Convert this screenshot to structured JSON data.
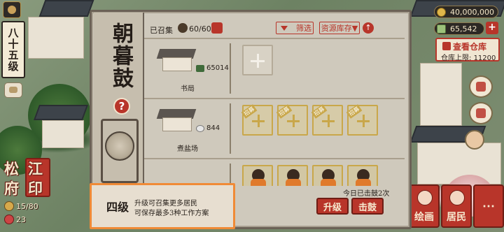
{
  "rank": {
    "title": "八十五级"
  },
  "city": {
    "name_part1": "松",
    "name_part2": "江",
    "name_part3": "府",
    "name_part4": "印",
    "population": "15/80",
    "other": "23"
  },
  "resources": {
    "coins": "40,000,000",
    "cash": "65,542",
    "plus_label": "+"
  },
  "warehouse": {
    "button_label": "查看仓库",
    "limit_label": "仓库上限:",
    "limit_value": "11200"
  },
  "side_buttons": {
    "painting": "绘画",
    "residents": "居民",
    "more": "⋯"
  },
  "dialog": {
    "title": "朝暮鼓",
    "help": "?",
    "recruited_label": "已召集",
    "recruited_count": "60/60",
    "filter_label": "筛选",
    "stock_label": "资源库存▼",
    "sort_label": "↑",
    "rows": [
      {
        "building": "书局",
        "stat": "65014"
      },
      {
        "building": "煮盐场",
        "stat": "844",
        "job_tag": "招募"
      }
    ],
    "level": "四级",
    "info_line1": "升级可召集更多居民",
    "info_line2": "可保存最多3种工作方案",
    "today": "今日已击鼓2次",
    "upgrade_label": "升级",
    "beat_label": "击鼓"
  },
  "colors": {
    "accent": "#b8352a",
    "highlight": "#f08a36",
    "panel": "#cfc9bc"
  }
}
